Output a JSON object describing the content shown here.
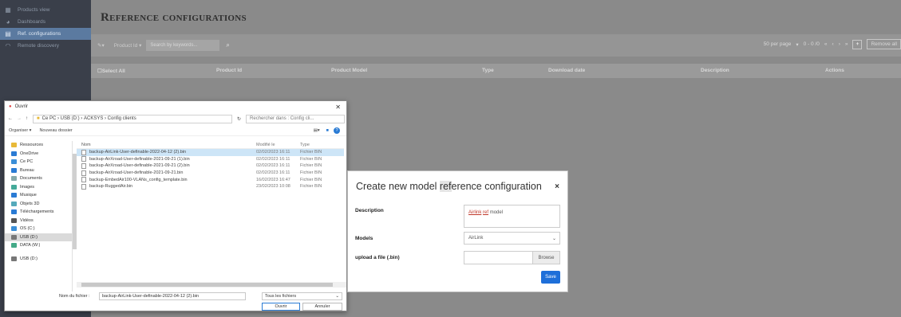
{
  "sidebar": {
    "items": [
      {
        "label": "Products view",
        "icon": "grid-icon"
      },
      {
        "label": "Dashboards",
        "icon": "palette-icon"
      },
      {
        "label": "Ref. configurations",
        "icon": "document-icon"
      },
      {
        "label": "Remote discovery",
        "icon": "wifi-icon"
      }
    ]
  },
  "header": {
    "title": "Reference configurations"
  },
  "toolbar": {
    "product_id_label": "Product Id ▾",
    "search_placeholder": "Search by keywords...",
    "per_page": "50 per page",
    "pagination": "0 - 0 /0",
    "add_label": "+",
    "remove_label": "Remove all"
  },
  "table": {
    "columns": [
      "Select All",
      "Product Id",
      "Product Model",
      "Type",
      "Download date",
      "Description",
      "Actions"
    ]
  },
  "file_dialog": {
    "title": "Ouvrir",
    "path": [
      "Ce PC",
      "USB (D:)",
      "ACKSYS",
      "Config clients"
    ],
    "search_placeholder": "Rechercher dans : Config cli...",
    "organize": "Organiser ▾",
    "new_folder": "Nouveau dossier",
    "nav": [
      {
        "label": "Ressources",
        "icon": "folder-icon"
      },
      {
        "label": "OneDrive",
        "icon": "cloud-icon"
      },
      {
        "label": "Ce PC",
        "icon": "computer-icon"
      },
      {
        "label": "Bureau",
        "icon": "desktop-icon"
      },
      {
        "label": "Documents",
        "icon": "documents-icon"
      },
      {
        "label": "Images",
        "icon": "images-icon"
      },
      {
        "label": "Musique",
        "icon": "music-icon"
      },
      {
        "label": "Objets 3D",
        "icon": "cube-icon"
      },
      {
        "label": "Téléchargements",
        "icon": "download-icon"
      },
      {
        "label": "Vidéos",
        "icon": "video-icon"
      },
      {
        "label": "OS (C:)",
        "icon": "drive-icon"
      },
      {
        "label": "USB (D:)",
        "icon": "usb-icon"
      },
      {
        "label": "DATA (W:)",
        "icon": "network-drive-icon"
      },
      {
        "label": "USB (D:)",
        "icon": "usb-icon"
      }
    ],
    "columns": [
      "Nom",
      "Modifié le",
      "Type"
    ],
    "files": [
      {
        "name": "backup-AirLink-User-definable-2022-04-12 (2).bin",
        "modified": "02/02/2023 16:11",
        "type": "Fichier BIN"
      },
      {
        "name": "backup-AirXroad-User-definable-2021-09-21 (1).bin",
        "modified": "02/02/2023 16:11",
        "type": "Fichier BIN"
      },
      {
        "name": "backup-AirXroad-User-definable-2021-09-21 (2).bin",
        "modified": "02/02/2023 16:11",
        "type": "Fichier BIN"
      },
      {
        "name": "backup-AirXroad-User-definable-2021-09-21.bin",
        "modified": "02/02/2023 16:11",
        "type": "Fichier BIN"
      },
      {
        "name": "backup-EmbedAir100-VLANs_config_template.bin",
        "modified": "16/02/2023 16:47",
        "type": "Fichier BIN"
      },
      {
        "name": "backup-RuggedAir.bin",
        "modified": "23/02/2023 10:08",
        "type": "Fichier BIN"
      }
    ],
    "filename_label": "Nom du fichier :",
    "filename_value": "backup-AirLink-User-definable-2022-04-12 (2).bin",
    "filetype": "Tous les fichiers",
    "open_label": "Ouvrir",
    "cancel_label": "Annuler"
  },
  "modal": {
    "title_a": "Create new model ",
    "title_hl": "ref",
    "title_b": "erence configuration",
    "close": "×",
    "description_label": "Description",
    "description_value_a": "Airlink",
    "description_value_b": " ",
    "description_value_c": "ref",
    "description_value_d": " model",
    "models_label": "Models",
    "models_value": "AirLink",
    "upload_label": "upload a file (.bin)",
    "browse_label": "Browse",
    "save_label": "Save"
  },
  "colors": {
    "accent": "#1e6fd9",
    "sidebar_bg": "#3a3f4a",
    "active": "#5b7aa0"
  }
}
